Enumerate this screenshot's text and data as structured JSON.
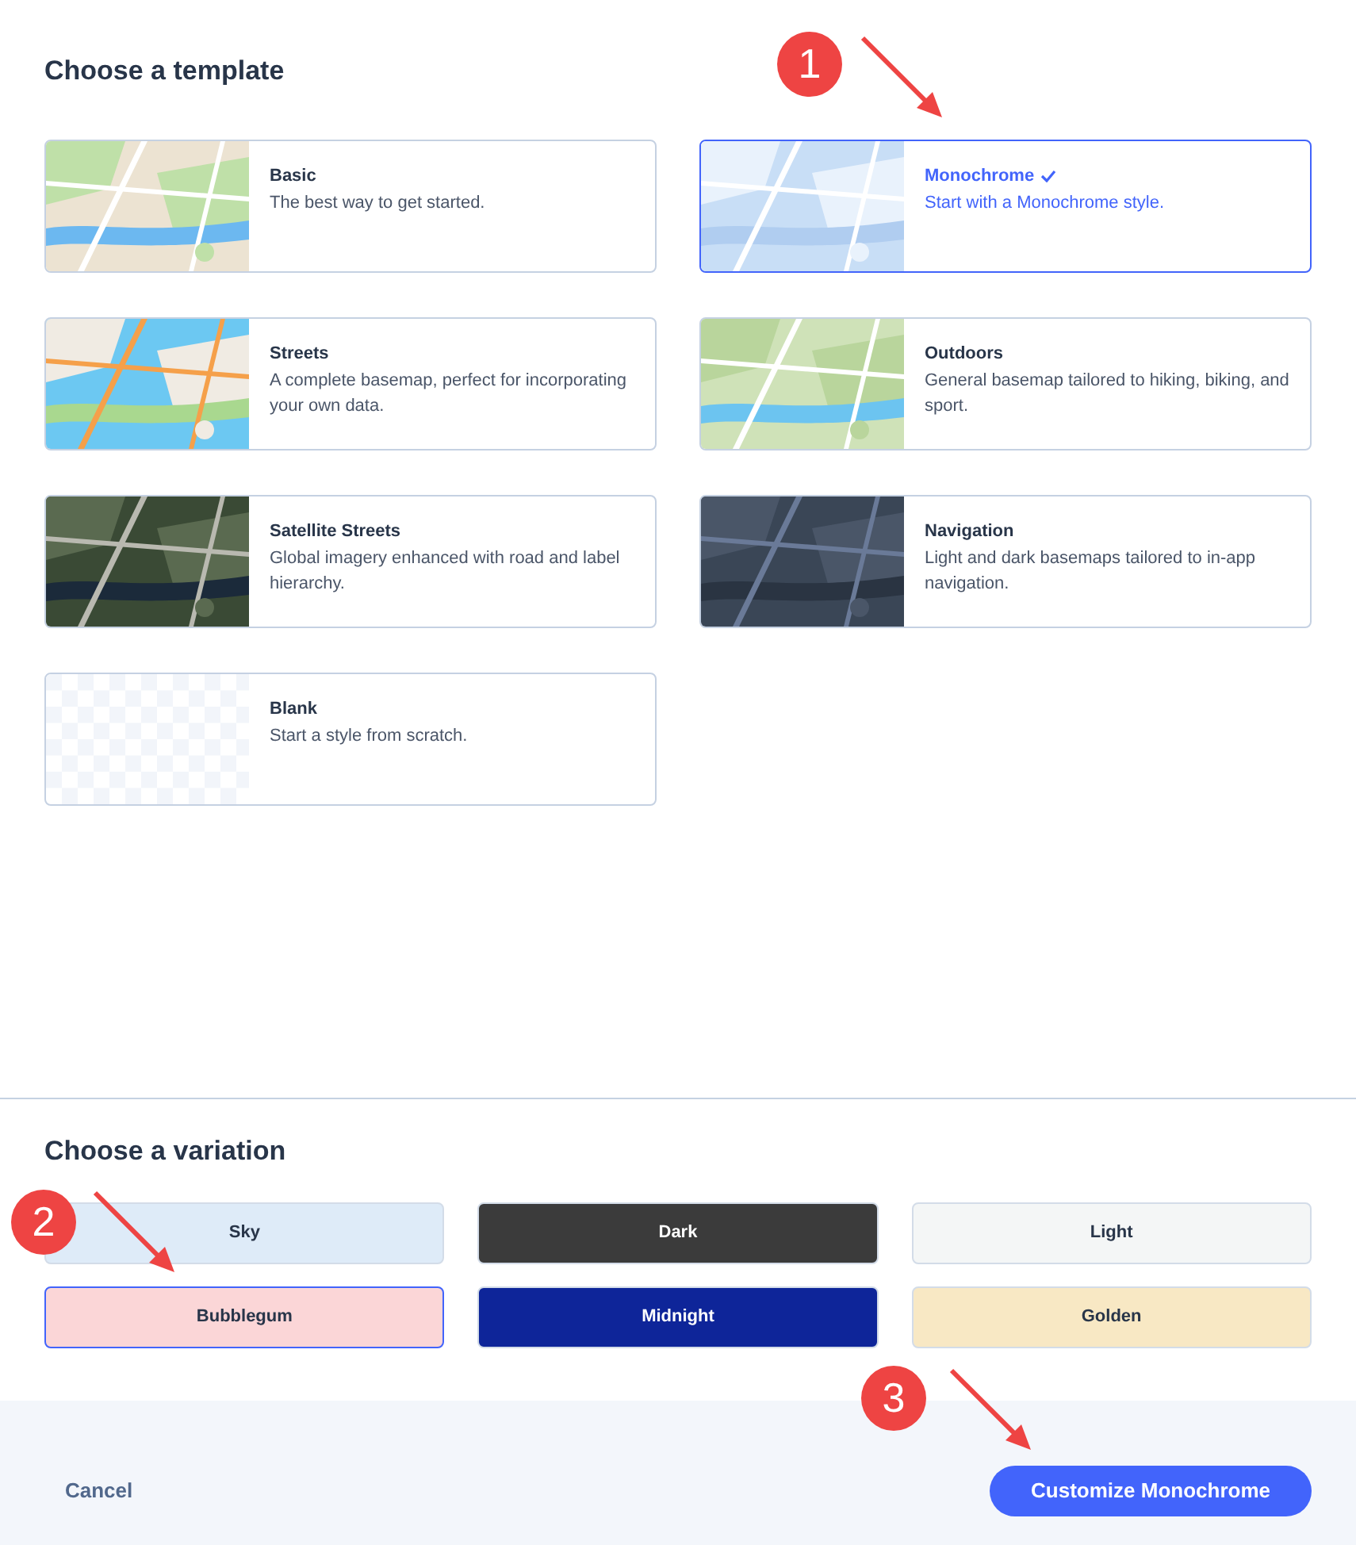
{
  "templates_heading": "Choose a template",
  "templates": [
    {
      "kind": "map",
      "title": "Basic",
      "description": "The best way to get started.",
      "selected": false
    },
    {
      "kind": "map",
      "title": "Monochrome",
      "description": "Start with a Monochrome style.",
      "selected": true
    },
    {
      "kind": "map",
      "title": "Streets",
      "description": "A complete basemap, perfect for incorporating your own data.",
      "selected": false
    },
    {
      "kind": "map",
      "title": "Outdoors",
      "description": "General basemap tailored to hiking, biking, and sport.",
      "selected": false
    },
    {
      "kind": "map",
      "title": "Satellite Streets",
      "description": "Global imagery enhanced with road and label hierarchy.",
      "selected": false
    },
    {
      "kind": "map",
      "title": "Navigation",
      "description": "Light and dark basemaps tailored to in-app navigation.",
      "selected": false
    },
    {
      "kind": "blank",
      "title": "Blank",
      "description": "Start a style from scratch.",
      "selected": false
    }
  ],
  "variations_heading": "Choose a variation",
  "variations": [
    {
      "label": "Sky",
      "color": "#deebf8",
      "selected": false
    },
    {
      "label": "Dark",
      "color": "#3b3b3b",
      "selected": false
    },
    {
      "label": "Light",
      "color": "#f4f6f6",
      "selected": false
    },
    {
      "label": "Bubblegum",
      "color": "#fbd6d7",
      "selected": true
    },
    {
      "label": "Midnight",
      "color": "#0e2599",
      "selected": false
    },
    {
      "label": "Golden",
      "color": "#f8e8c4",
      "selected": false
    }
  ],
  "footer": {
    "cancel": "Cancel",
    "primary": "Customize Monochrome"
  },
  "callouts": [
    {
      "label": "1"
    },
    {
      "label": "2"
    },
    {
      "label": "3"
    }
  ]
}
